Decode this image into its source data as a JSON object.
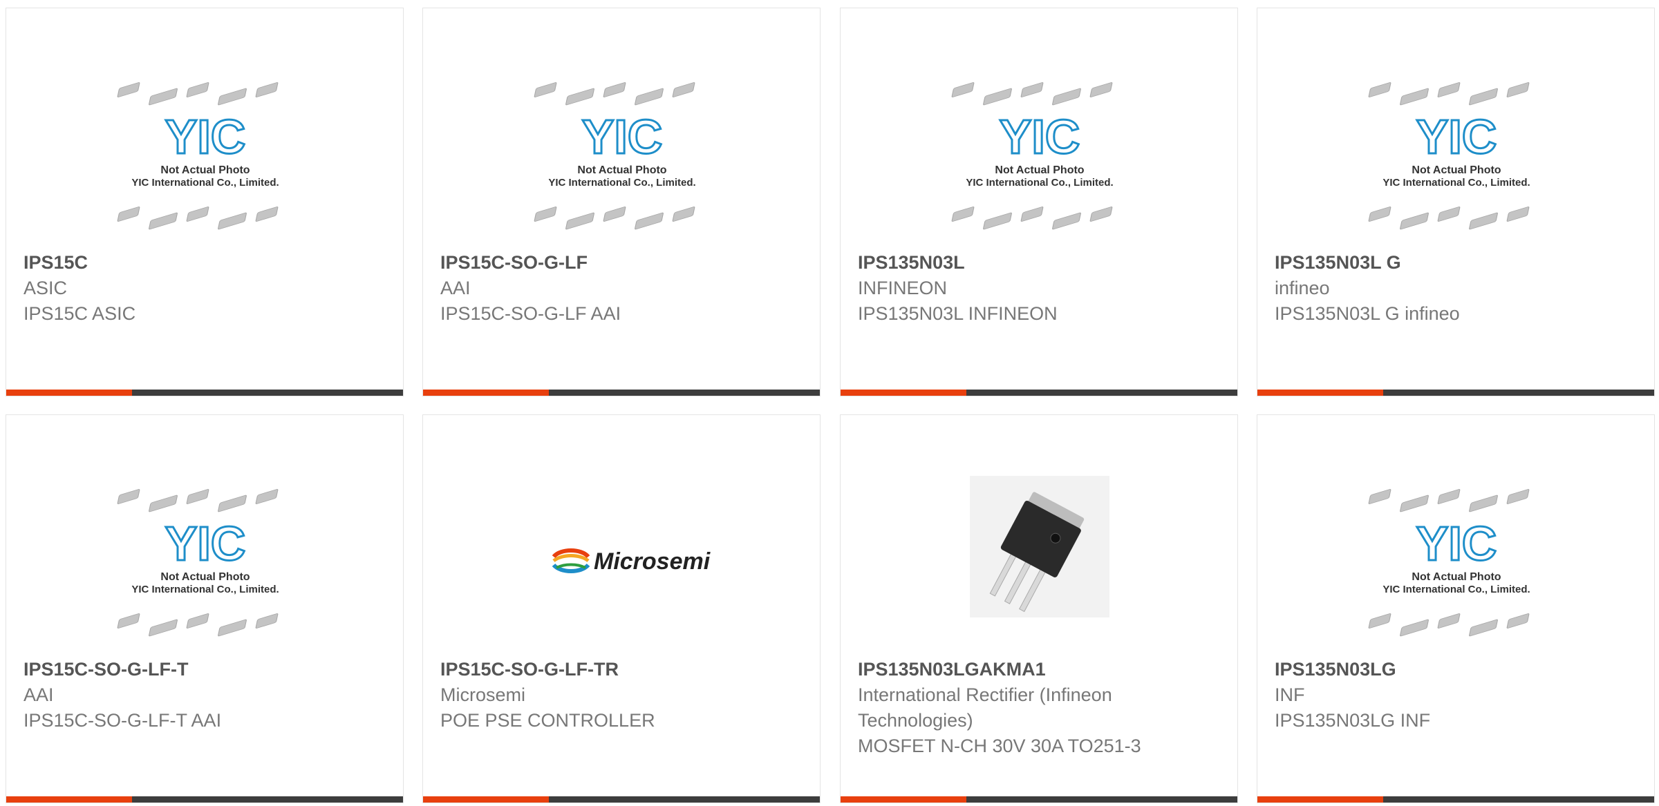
{
  "placeholder": {
    "line1": "Not Actual Photo",
    "line2": "YIC International Co., Limited.",
    "logo": "YIC"
  },
  "products": [
    {
      "part": "IPS15C",
      "maker": "ASIC",
      "desc": "IPS15C ASIC",
      "image": "yic-placeholder"
    },
    {
      "part": "IPS15C-SO-G-LF",
      "maker": "AAI",
      "desc": "IPS15C-SO-G-LF AAI",
      "image": "yic-placeholder"
    },
    {
      "part": "IPS135N03L",
      "maker": "INFINEON",
      "desc": "IPS135N03L INFINEON",
      "image": "yic-placeholder"
    },
    {
      "part": "IPS135N03L G",
      "maker": "infineo",
      "desc": "IPS135N03L G infineo",
      "image": "yic-placeholder"
    },
    {
      "part": "IPS15C-SO-G-LF-T",
      "maker": "AAI",
      "desc": "IPS15C-SO-G-LF-T AAI",
      "image": "yic-placeholder"
    },
    {
      "part": "IPS15C-SO-G-LF-TR",
      "maker": "Microsemi",
      "desc": "POE PSE CONTROLLER",
      "image": "microsemi-logo",
      "logo_text": "Microsemi"
    },
    {
      "part": "IPS135N03LGAKMA1",
      "maker": "International Rectifier (Infineon Technologies)",
      "desc": "MOSFET N-CH 30V 30A TO251-3",
      "image": "to251-package-photo"
    },
    {
      "part": "IPS135N03LG",
      "maker": "INF",
      "desc": "IPS135N03LG INF",
      "image": "yic-placeholder"
    }
  ],
  "colors": {
    "accent": "#e8400e",
    "bar": "#3d3d3d",
    "logo_blue": "#1e8ec9",
    "border": "#e4e4e4"
  }
}
